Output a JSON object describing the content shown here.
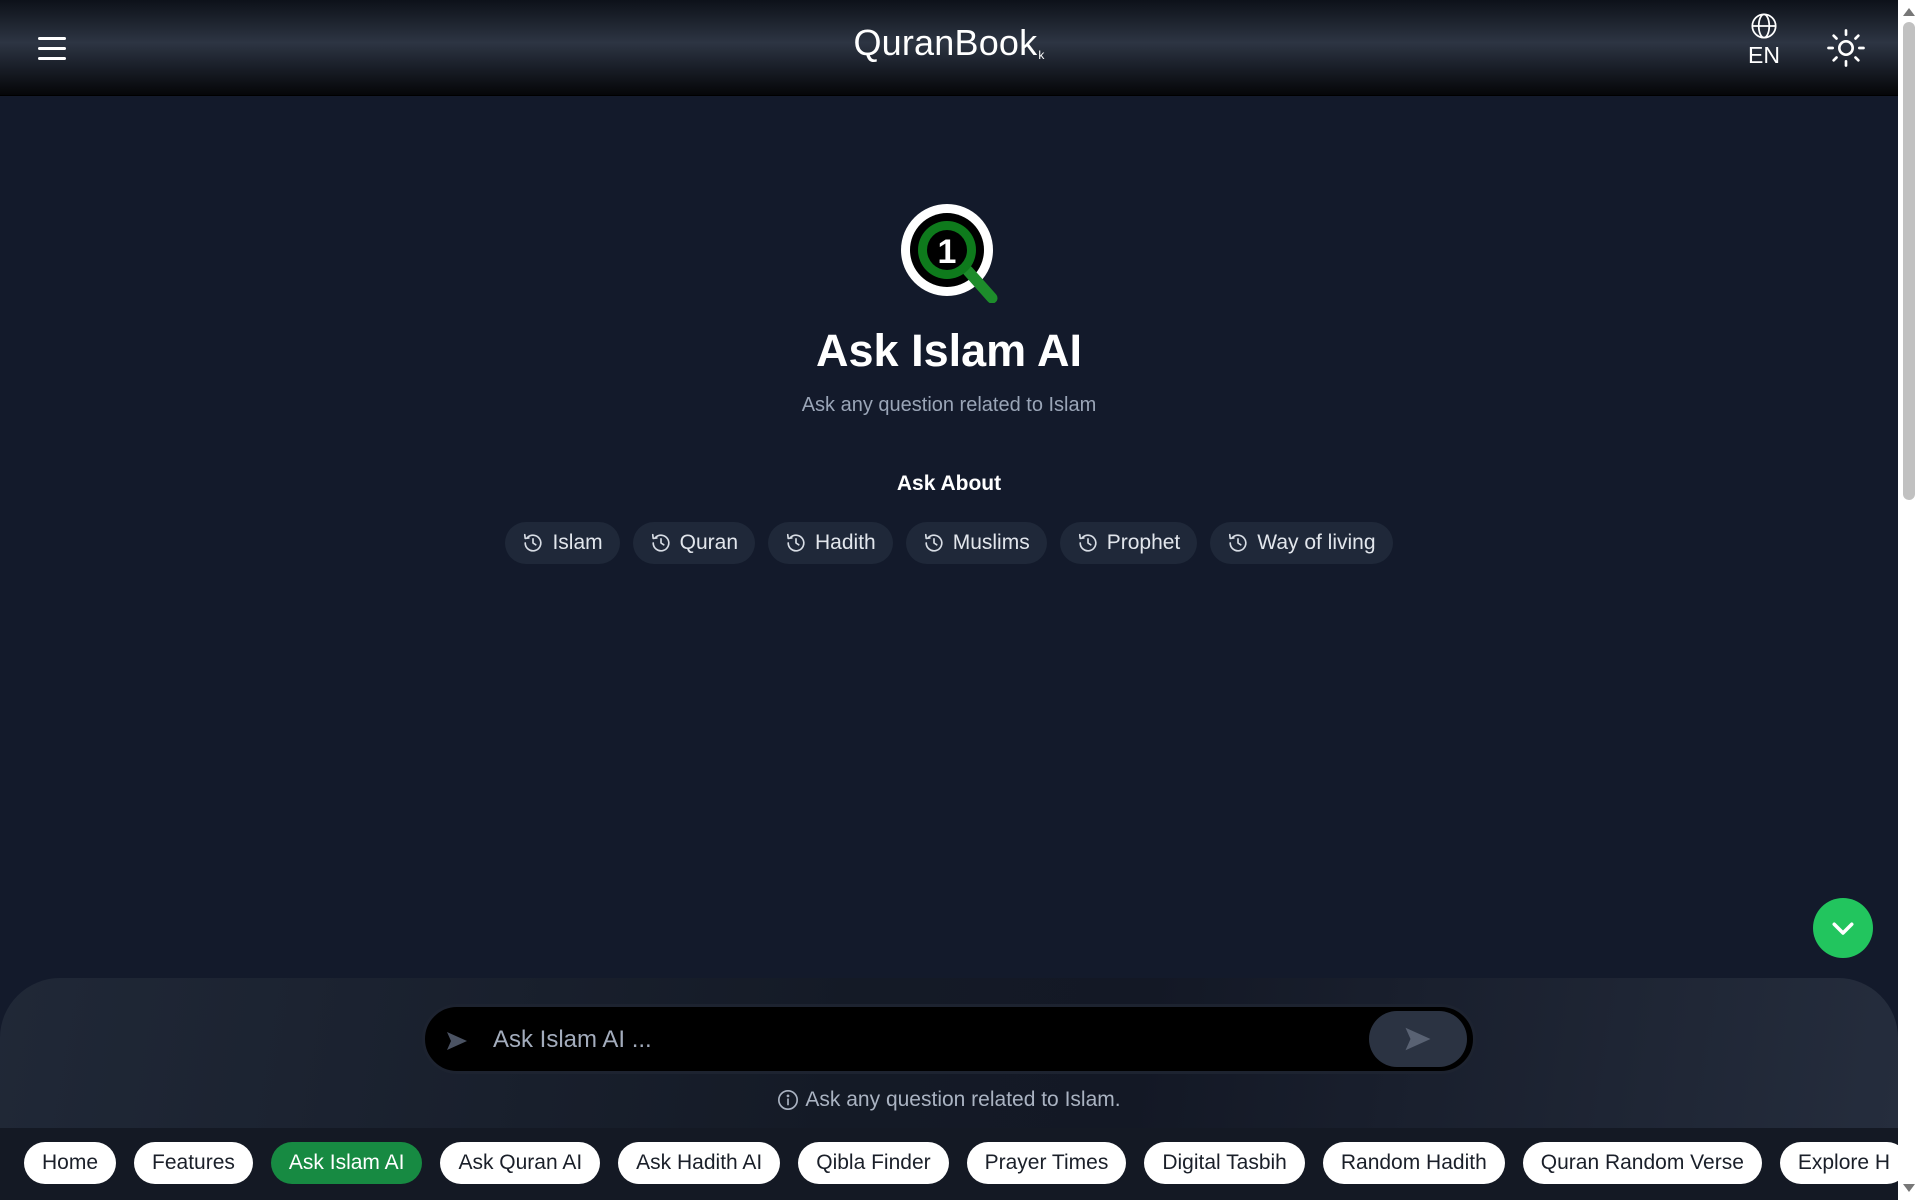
{
  "header": {
    "brand": "QuranBook",
    "brand_mark": "k",
    "language": "EN"
  },
  "hero": {
    "title": "Ask Islam AI",
    "subtitle": "Ask any question related to Islam",
    "ask_about_label": "Ask About",
    "topics": [
      "Islam",
      "Quran",
      "Hadith",
      "Muslims",
      "Prophet",
      "Way of living"
    ]
  },
  "chat": {
    "placeholder": "Ask Islam AI ...",
    "hint": "Ask any question related to Islam."
  },
  "nav": {
    "items": [
      "Home",
      "Features",
      "Ask Islam AI",
      "Ask Quran AI",
      "Ask Hadith AI",
      "Qibla Finder",
      "Prayer Times",
      "Digital Tasbih",
      "Random Hadith",
      "Quran Random Verse",
      "Explore H"
    ],
    "active": "Ask Islam AI"
  },
  "colors": {
    "background": "#131a2b",
    "accent_green": "#22c55e",
    "active_pill": "#178a42"
  },
  "icons": {
    "menu": "hamburger-menu-icon",
    "language": "globe-icon",
    "theme": "sun-icon",
    "topic": "history-icon",
    "send": "send-icon",
    "scroll": "chevron-down-icon",
    "hint": "info-icon"
  }
}
